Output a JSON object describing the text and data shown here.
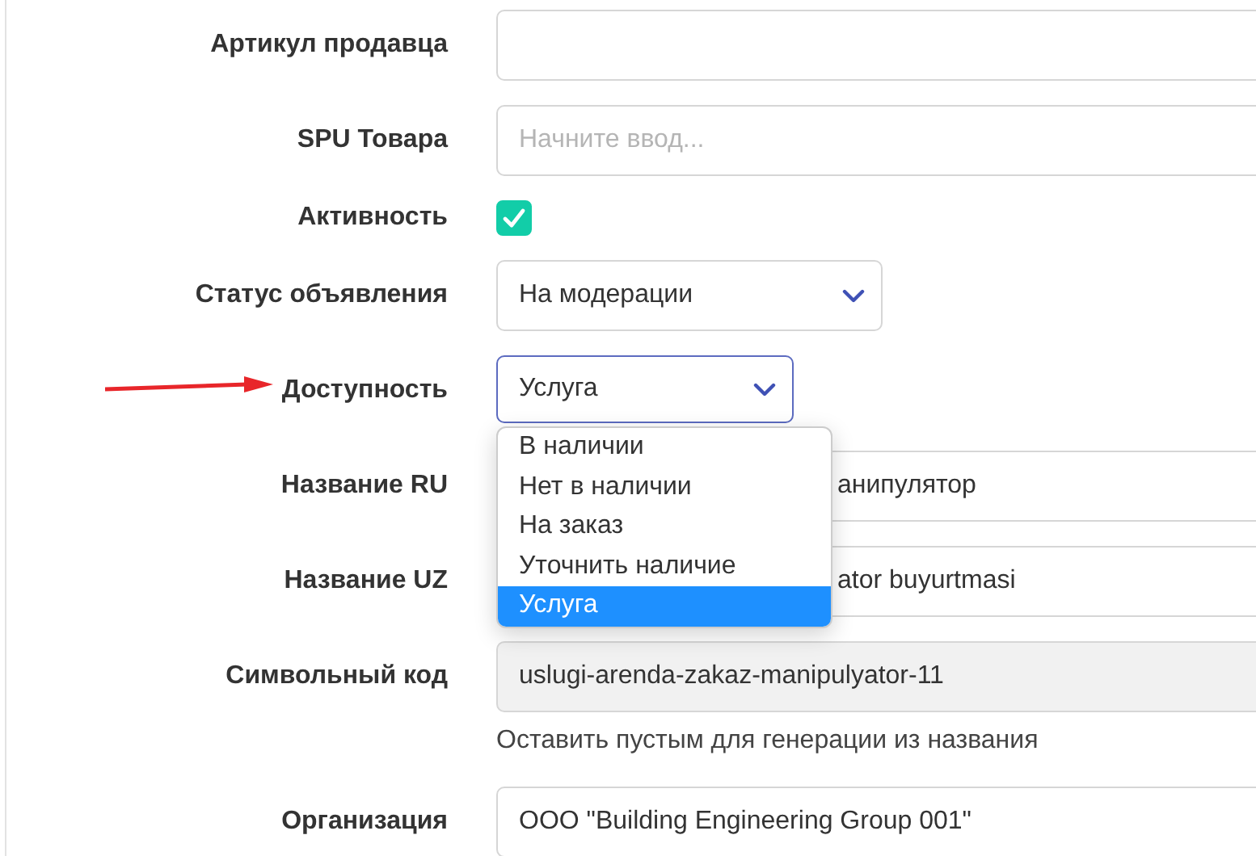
{
  "fields": [
    {
      "kind": "text",
      "label": "Артикул продавца"
    },
    {
      "kind": "text",
      "label": "SPU Товара",
      "placeholder": "Начните ввод..."
    },
    {
      "kind": "checkbox",
      "label": "Активность",
      "checked": true
    },
    {
      "kind": "select",
      "label": "Статус объявления",
      "value": "На модерации",
      "expanded": false
    },
    {
      "kind": "select",
      "label": "Доступность",
      "value": "Услуга",
      "expanded": true,
      "annotated": true,
      "options": [
        {
          "label": "В наличии",
          "selected": false
        },
        {
          "label": "Нет в наличии",
          "selected": false
        },
        {
          "label": "На заказ",
          "selected": false
        },
        {
          "label": "Уточнить наличие",
          "selected": false
        },
        {
          "label": "Услуга",
          "selected": true
        }
      ]
    },
    {
      "kind": "text",
      "label": "Название RU",
      "value": "анипулятор"
    },
    {
      "kind": "text",
      "label": "Название UZ",
      "value": "ator buyurtmasi"
    },
    {
      "kind": "text",
      "label": "Символьный код",
      "value": "uslugi-arenda-zakaz-manipulyator-11",
      "readonly": true,
      "hint": "Оставить пустым для генерации из названия"
    },
    {
      "kind": "text",
      "label": "Организация",
      "value": "ООО \"Building Engineering Group 001\""
    }
  ]
}
